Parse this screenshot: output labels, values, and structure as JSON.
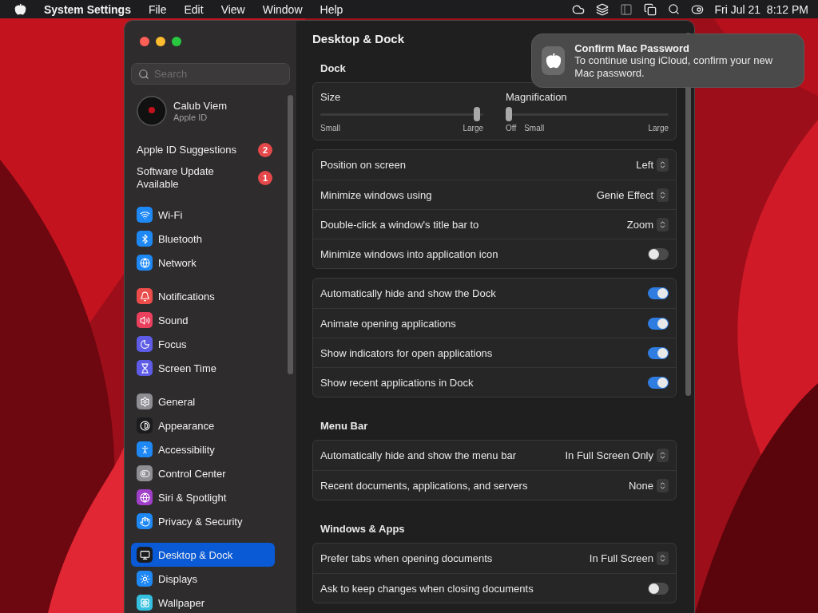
{
  "menu_bar": {
    "app": "System Settings",
    "menus": [
      "File",
      "Edit",
      "View",
      "Window",
      "Help"
    ],
    "clock": "Fri Jul 21  8:12 PM"
  },
  "sidebar": {
    "search": {
      "placeholder": "Search"
    },
    "account": {
      "name": "Calub Viem",
      "subtitle": "Apple ID"
    },
    "alerts": [
      {
        "label": "Apple ID Suggestions",
        "badge": "2"
      },
      {
        "label": "Software Update Available",
        "badge": "1"
      }
    ],
    "groups": [
      [
        {
          "label": "Wi-Fi",
          "kind": "wifi",
          "color": "#1e88f5",
          "selected": false
        },
        {
          "label": "Bluetooth",
          "kind": "bluetooth",
          "color": "#1e88f5",
          "selected": false
        },
        {
          "label": "Network",
          "kind": "globe",
          "color": "#1e88f5",
          "selected": false
        }
      ],
      [
        {
          "label": "Notifications",
          "kind": "bell",
          "color": "#eb4d4b",
          "selected": false
        },
        {
          "label": "Sound",
          "kind": "sound",
          "color": "#eb3f5e",
          "selected": false
        },
        {
          "label": "Focus",
          "kind": "moon",
          "color": "#5e5ce6",
          "selected": false
        },
        {
          "label": "Screen Time",
          "kind": "hourglass",
          "color": "#5e5ce6",
          "selected": false
        }
      ],
      [
        {
          "label": "General",
          "kind": "gear",
          "color": "#8e8e93",
          "selected": false
        },
        {
          "label": "Appearance",
          "kind": "contrast",
          "color": "#1c1c1e",
          "selected": false
        },
        {
          "label": "Accessibility",
          "kind": "person",
          "color": "#1e88f5",
          "selected": false
        },
        {
          "label": "Control Center",
          "kind": "toggles",
          "color": "#8e8e93",
          "selected": false
        },
        {
          "label": "Siri & Spotlight",
          "kind": "orb",
          "color": "#a03fc8",
          "selected": false
        },
        {
          "label": "Privacy & Security",
          "kind": "hand",
          "color": "#1e88f5",
          "selected": false
        }
      ],
      [
        {
          "label": "Desktop & Dock",
          "kind": "dock",
          "color": "#1c1c1e",
          "selected": true
        },
        {
          "label": "Displays",
          "kind": "sun",
          "color": "#1e88f5",
          "selected": false
        },
        {
          "label": "Wallpaper",
          "kind": "flower",
          "color": "#35c0e0",
          "selected": false
        }
      ]
    ]
  },
  "content": {
    "title": "Desktop & Dock",
    "sections": [
      {
        "heading": "Dock",
        "groups": [
          {
            "kind": "sliders",
            "sliders": [
              {
                "label": "Size",
                "level": 0.98,
                "ticks": [
                  "Small",
                  "Large"
                ]
              },
              {
                "label": "Magnification",
                "level": 0,
                "ticks": [
                  "Off",
                  "Small",
                  "Large"
                ]
              }
            ]
          },
          {
            "kind": "rows",
            "rows": [
              {
                "kind": "select",
                "label": "Position on screen",
                "value": "Left"
              },
              {
                "kind": "select",
                "label": "Minimize windows using",
                "value": "Genie Effect"
              },
              {
                "kind": "select",
                "label": "Double-click a window's title bar to",
                "value": "Zoom"
              },
              {
                "kind": "toggle",
                "label": "Minimize windows into application icon",
                "on": false
              }
            ]
          },
          {
            "kind": "rows",
            "rows": [
              {
                "kind": "toggle",
                "label": "Automatically hide and show the Dock",
                "on": true
              },
              {
                "kind": "toggle",
                "label": "Animate opening applications",
                "on": true
              },
              {
                "kind": "toggle",
                "label": "Show indicators for open applications",
                "on": true
              },
              {
                "kind": "toggle",
                "label": "Show recent applications in Dock",
                "on": true
              }
            ]
          }
        ]
      },
      {
        "heading": "Menu Bar",
        "groups": [
          {
            "kind": "rows",
            "rows": [
              {
                "kind": "select",
                "label": "Automatically hide and show the menu bar",
                "value": "In Full Screen Only"
              },
              {
                "kind": "select",
                "label": "Recent documents, applications, and servers",
                "value": "None"
              }
            ]
          }
        ]
      },
      {
        "heading": "Windows & Apps",
        "groups": [
          {
            "kind": "rows",
            "rows": [
              {
                "kind": "select",
                "label": "Prefer tabs when opening documents",
                "value": "In Full Screen"
              },
              {
                "kind": "toggle",
                "label": "Ask to keep changes when closing documents",
                "on": false
              }
            ]
          }
        ]
      }
    ]
  },
  "notification": {
    "title": "Confirm Mac Password",
    "body": "To continue using iCloud, confirm your new Mac password."
  }
}
